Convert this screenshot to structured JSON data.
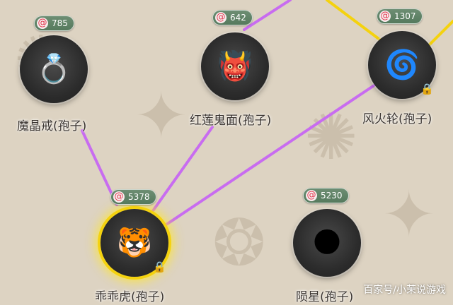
{
  "colors": {
    "link_purple": "#c86cf0",
    "link_yellow": "#f4d20f",
    "badge_green": "#5f8466",
    "selected_glow": "#f4d20f",
    "background": "#ddd3c2"
  },
  "nodes": [
    {
      "key": "magic-crystal-ring",
      "label": "魔晶戒(孢子)",
      "cost": "785",
      "icon": "ring-icon",
      "glyph": "💍",
      "locked": false,
      "selected": false
    },
    {
      "key": "red-lotus-mask",
      "label": "红莲鬼面(孢子)",
      "cost": "642",
      "icon": "demon-mask-icon",
      "glyph": "👹",
      "locked": false,
      "selected": false
    },
    {
      "key": "wind-fire-wheel",
      "label": "风火轮(孢子)",
      "cost": "1307",
      "icon": "fire-wheel-icon",
      "glyph": "🌀",
      "locked": true,
      "selected": false
    },
    {
      "key": "guai-guai-tiger",
      "label": "乖乖虎(孢子)",
      "cost": "5378",
      "icon": "tiger-icon",
      "glyph": "🐯",
      "locked": true,
      "selected": true
    },
    {
      "key": "meteor",
      "label": "陨星(孢子)",
      "cost": "5230",
      "icon": "meteor-orb-icon",
      "glyph": "🌑",
      "locked": false,
      "selected": false
    }
  ],
  "watermark": "百家号/小茉说游戏"
}
